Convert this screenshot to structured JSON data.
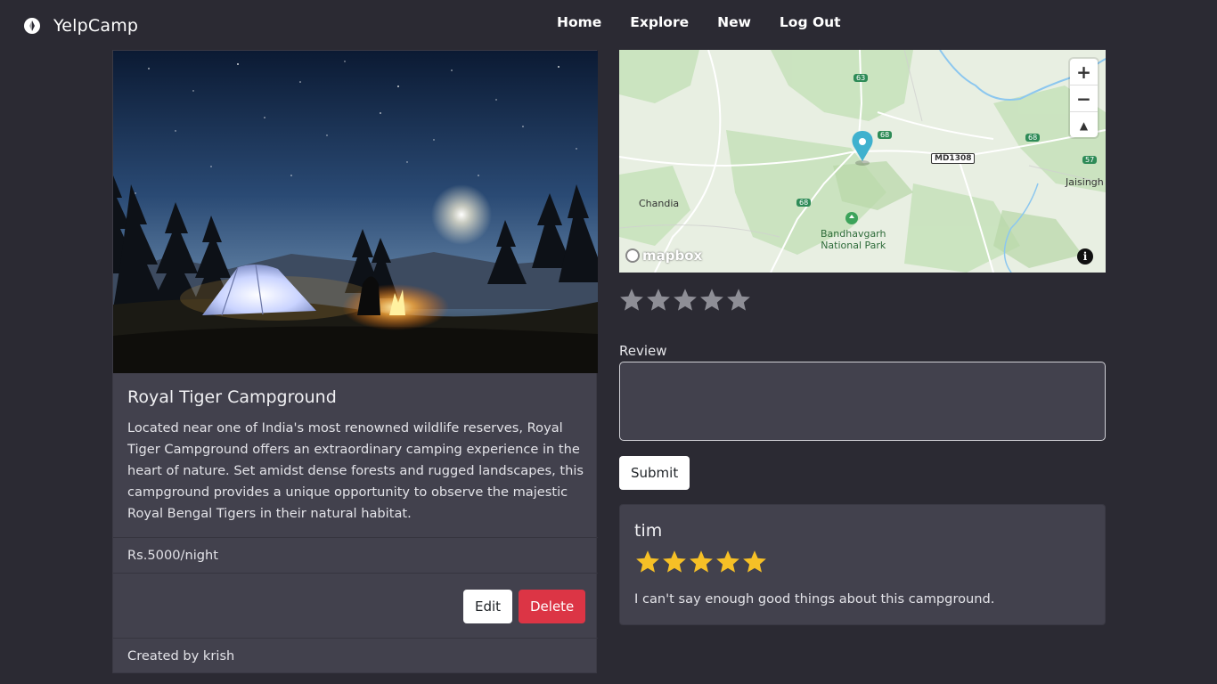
{
  "nav": {
    "brand": "YelpCamp",
    "links": [
      "Home",
      "Explore",
      "New",
      "Log Out"
    ]
  },
  "campground": {
    "title": "Royal Tiger Campground",
    "description": "Located near one of India's most renowned wildlife reserves, Royal Tiger Campground offers an extraordinary camping experience in the heart of nature. Set amidst dense forests and rugged landscapes, this campground provides a unique opportunity to observe the majestic Royal Bengal Tigers in their natural habitat.",
    "price": "Rs.5000/night",
    "edit_label": "Edit",
    "delete_label": "Delete",
    "created_by": "Created by krish",
    "image_icon": "night-camping-photo"
  },
  "map": {
    "labels": {
      "chandia": "Chandia",
      "park": "Bandhavgarh\nNational Park",
      "jaisingh": "Jaisingh",
      "road_md": "MD1308",
      "road_63": "63",
      "road_68a": "68",
      "road_68b": "68",
      "road_68c": "68",
      "road_57": "57"
    },
    "zoom_in": "+",
    "zoom_out": "−",
    "compass": "▲",
    "logo": "mapbox",
    "info": "i"
  },
  "review_form": {
    "rating_value": 0,
    "rating_max": 5,
    "label": "Review",
    "placeholder": "",
    "submit_label": "Submit"
  },
  "reviews": [
    {
      "author": "tim",
      "rating": 5,
      "body": "I can't say enough good things about this campground."
    }
  ],
  "colors": {
    "background": "#2b2a33",
    "card": "#42414d",
    "star_filled": "#f6c026",
    "star_empty": "#8e8e96",
    "danger": "#dc3545"
  }
}
